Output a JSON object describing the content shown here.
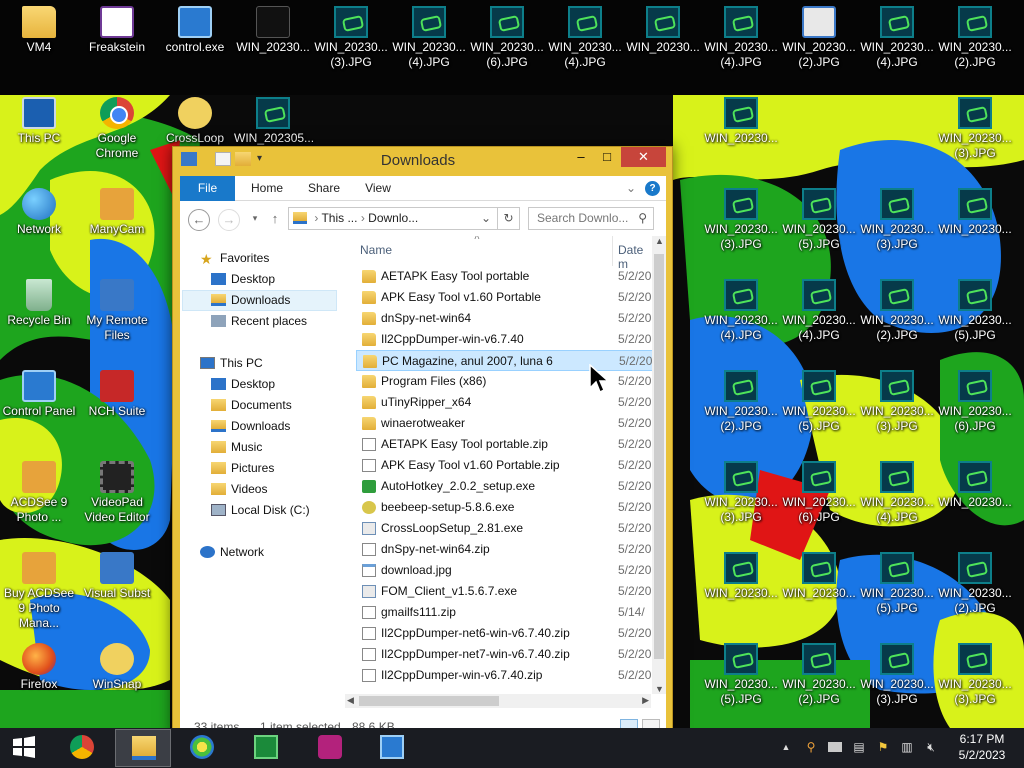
{
  "desktop": {
    "icons": [
      {
        "label": "VM4",
        "kind": "folder"
      },
      {
        "label": "Freakstein",
        "kind": "freak"
      },
      {
        "label": "control.exe",
        "kind": "panel"
      },
      {
        "label": "WIN_20230...",
        "kind": "dark"
      },
      {
        "label": "WIN_20230... (3).JPG",
        "kind": "thumb"
      },
      {
        "label": "WIN_20230... (4).JPG",
        "kind": "thumb"
      },
      {
        "label": "WIN_20230... (6).JPG",
        "kind": "thumb"
      },
      {
        "label": "WIN_20230... (4).JPG",
        "kind": "thumb"
      },
      {
        "label": "WIN_20230...",
        "kind": "thumb"
      },
      {
        "label": "WIN_20230... (4).JPG",
        "kind": "thumb"
      },
      {
        "label": "WIN_20230... (2).JPG",
        "kind": "exe"
      },
      {
        "label": "WIN_20230... (4).JPG",
        "kind": "thumb"
      },
      {
        "label": "WIN_20230... (2).JPG",
        "kind": "thumb"
      },
      {
        "label": "This PC",
        "kind": "pc"
      },
      {
        "label": "Google Chrome",
        "kind": "chrome"
      },
      {
        "label": "CrossLoop",
        "kind": "snap"
      },
      {
        "label": "WIN_202305...",
        "kind": "thumb"
      },
      {
        "label": "Network",
        "kind": "globe"
      },
      {
        "label": "ManyCam",
        "kind": "cam"
      },
      {
        "label": "Recycle Bin",
        "kind": "bin"
      },
      {
        "label": "My Remote Files",
        "kind": "sub"
      },
      {
        "label": "Control Panel",
        "kind": "panel"
      },
      {
        "label": "NCH Suite",
        "kind": "red"
      },
      {
        "label": "ACDSee 9 Photo ...",
        "kind": "cam"
      },
      {
        "label": "VideoPad Video Editor",
        "kind": "film"
      },
      {
        "label": "Buy ACDSee 9 Photo Mana...",
        "kind": "cam"
      },
      {
        "label": "Visual Subst",
        "kind": "sub"
      },
      {
        "label": "Firefox",
        "kind": "fox"
      },
      {
        "label": "WinSnap",
        "kind": "snap"
      },
      {
        "label": "WIN_20230... (3).JPG",
        "kind": "thumb"
      },
      {
        "label": "WIN_20230... (5).JPG",
        "kind": "thumb"
      },
      {
        "label": "WIN_20230... (3).JPG",
        "kind": "thumb"
      },
      {
        "label": "WIN_20230...",
        "kind": "thumb"
      },
      {
        "label": "WIN_20230... (4).JPG",
        "kind": "thumb"
      },
      {
        "label": "WIN_20230... (4).JPG",
        "kind": "thumb"
      },
      {
        "label": "WIN_20230... (2).JPG",
        "kind": "thumb"
      },
      {
        "label": "WIN_20230... (5).JPG",
        "kind": "thumb"
      },
      {
        "label": "WIN_20230... (2).JPG",
        "kind": "thumb"
      },
      {
        "label": "WIN_20230... (5).JPG",
        "kind": "thumb"
      },
      {
        "label": "WIN_20230... (3).JPG",
        "kind": "thumb"
      },
      {
        "label": "WIN_20230... (6).JPG",
        "kind": "thumb"
      },
      {
        "label": "WIN_20230... (3).JPG",
        "kind": "thumb"
      },
      {
        "label": "WIN_20230... (6).JPG",
        "kind": "thumb"
      },
      {
        "label": "WIN_20230... (4).JPG",
        "kind": "thumb"
      },
      {
        "label": "WIN_20230...",
        "kind": "thumb"
      },
      {
        "label": "WIN_20230...",
        "kind": "thumb"
      },
      {
        "label": "WIN_20230...",
        "kind": "thumb"
      },
      {
        "label": "WIN_20230... (5).JPG",
        "kind": "thumb"
      },
      {
        "label": "WIN_20230... (2).JPG",
        "kind": "thumb"
      },
      {
        "label": "WIN_20230... (5).JPG",
        "kind": "thumb"
      },
      {
        "label": "WIN_20230... (2).JPG",
        "kind": "thumb"
      },
      {
        "label": "WIN_20230... (3).JPG",
        "kind": "thumb"
      },
      {
        "label": "WIN_20230... (3).JPG",
        "kind": "thumb"
      },
      {
        "label": "WIN_20230...",
        "kind": "thumb"
      },
      {
        "label": "WIN_20230... (3).JPG",
        "kind": "thumb"
      }
    ]
  },
  "window": {
    "title": "Downloads",
    "minimize": "–",
    "maximize": "□",
    "close": "✕",
    "ribbon_tabs": {
      "file": "File",
      "home": "Home",
      "share": "Share",
      "view": "View"
    },
    "help": "?",
    "address": {
      "seg1": "This ...",
      "seg2": "Downlo..."
    },
    "search_placeholder": "Search Downlo...",
    "nav": {
      "favorites": "Favorites",
      "desktop": "Desktop",
      "downloads": "Downloads",
      "recent": "Recent places",
      "this_pc": "This PC",
      "pc_desktop": "Desktop",
      "documents": "Documents",
      "pc_downloads": "Downloads",
      "music": "Music",
      "pictures": "Pictures",
      "videos": "Videos",
      "local_disk": "Local Disk (C:)",
      "network": "Network"
    },
    "columns": {
      "name": "Name",
      "date": "Date m"
    },
    "files": [
      {
        "name": "AETAPK Easy Tool portable",
        "date": "5/2/20",
        "type": "folder"
      },
      {
        "name": "APK Easy Tool v1.60 Portable",
        "date": "5/2/20",
        "type": "folder"
      },
      {
        "name": "dnSpy-net-win64",
        "date": "5/2/20",
        "type": "folder"
      },
      {
        "name": "Il2CppDumper-win-v6.7.40",
        "date": "5/2/20",
        "type": "folder"
      },
      {
        "name": "PC Magazine, anul 2007, luna 6",
        "date": "5/2/20",
        "type": "folder"
      },
      {
        "name": "Program Files (x86)",
        "date": "5/2/20",
        "type": "folder"
      },
      {
        "name": "uTinyRipper_x64",
        "date": "5/2/20",
        "type": "folder"
      },
      {
        "name": "winaerotweaker",
        "date": "5/2/20",
        "type": "folder"
      },
      {
        "name": "AETAPK Easy Tool portable.zip",
        "date": "5/2/20",
        "type": "zip"
      },
      {
        "name": "APK Easy Tool v1.60 Portable.zip",
        "date": "5/2/20",
        "type": "zip"
      },
      {
        "name": "AutoHotkey_2.0.2_setup.exe",
        "date": "5/2/20",
        "type": "green"
      },
      {
        "name": "beebeep-setup-5.8.6.exe",
        "date": "5/2/20",
        "type": "bee"
      },
      {
        "name": "CrossLoopSetup_2.81.exe",
        "date": "5/2/20",
        "type": "exe"
      },
      {
        "name": "dnSpy-net-win64.zip",
        "date": "5/2/20",
        "type": "zip"
      },
      {
        "name": "download.jpg",
        "date": "5/2/20",
        "type": "jpg"
      },
      {
        "name": "FOM_Client_v1.5.6.7.exe",
        "date": "5/2/20",
        "type": "exe"
      },
      {
        "name": "gmailfs111.zip",
        "date": "5/14/",
        "type": "zip"
      },
      {
        "name": "Il2CppDumper-net6-win-v6.7.40.zip",
        "date": "5/2/20",
        "type": "zip"
      },
      {
        "name": "Il2CppDumper-net7-win-v6.7.40.zip",
        "date": "5/2/20",
        "type": "zip"
      },
      {
        "name": "Il2CppDumper-win-v6.7.40.zip",
        "date": "5/2/20",
        "type": "zip"
      }
    ],
    "status": {
      "count": "33 items",
      "selected": "1 item selected",
      "size": "88.6 KB"
    }
  },
  "taskbar": {
    "time": "6:17 PM",
    "date": "5/2/2023"
  },
  "colors": {
    "accent": "#1979ca",
    "window_frame": "#e9c23a",
    "close": "#c7453b",
    "selection": "#cce8ff"
  }
}
